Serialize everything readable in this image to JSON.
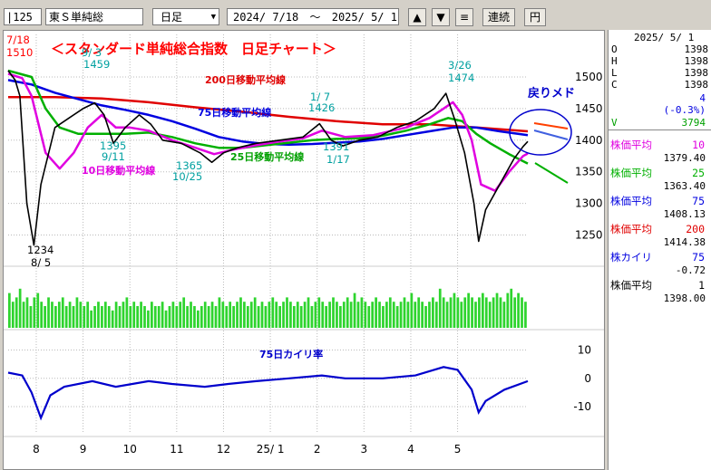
{
  "toolbar": {
    "code": "125",
    "name": "東Ｓ単純総",
    "period": "日足",
    "range_start": "2024/ 7/18",
    "range_sep": "～",
    "range_end": "2025/ 5/ 1",
    "btn_up": "▲",
    "btn_down": "▼",
    "btn_menu": "≡",
    "btn_renzoku": "連続",
    "btn_yen": "円"
  },
  "side": {
    "date": "2025/ 5/ 1",
    "ohlc": [
      {
        "k": "O",
        "v": "1398"
      },
      {
        "k": "H",
        "v": "1398"
      },
      {
        "k": "L",
        "v": "1398"
      },
      {
        "k": "C",
        "v": "1398"
      }
    ],
    "change": "4",
    "change_pct": "(-0.3%)",
    "volume_label": "V",
    "volume": "3794",
    "indicators": [
      {
        "label": "株価平均",
        "period": "10",
        "value": "1379.40",
        "color": "#e000e0"
      },
      {
        "label": "株価平均",
        "period": "25",
        "value": "1363.40",
        "color": "#00b000"
      },
      {
        "label": "株価平均",
        "period": "75",
        "value": "1408.13",
        "color": "#0000e0"
      },
      {
        "label": "株価平均",
        "period": "200",
        "value": "1414.38",
        "color": "#e00000"
      },
      {
        "label": "株カイリ",
        "period": "75",
        "value": "-0.72",
        "color": "#0000e0"
      },
      {
        "label": "株価平均",
        "period": "1",
        "value": "1398.00",
        "color": "#000000"
      }
    ]
  },
  "chart": {
    "title": "＜スタンダード単純総合指数　日足チャート＞",
    "ma_labels": {
      "ma200": "200日移動平均線",
      "ma75": "75日移動平均線",
      "ma25": "25日移動平均線",
      "ma10": "10日移動平均線"
    },
    "modori": "戻りメド",
    "kairi_label": "75日カイリ率",
    "annotations": [
      {
        "text": "7/18",
        "color": "#ff0000"
      },
      {
        "text": "1510",
        "color": "#ff0000"
      },
      {
        "text": "9/ 3",
        "color": "#00a0a0"
      },
      {
        "text": "1459",
        "color": "#00a0a0"
      },
      {
        "text": "1395",
        "color": "#00a0a0"
      },
      {
        "text": "9/11",
        "color": "#00a0a0"
      },
      {
        "text": "1365",
        "color": "#00a0a0"
      },
      {
        "text": "10/25",
        "color": "#00a0a0"
      },
      {
        "text": "1/ 7",
        "color": "#00a0a0"
      },
      {
        "text": "1426",
        "color": "#00a0a0"
      },
      {
        "text": "1391",
        "color": "#00a0a0"
      },
      {
        "text": "1/17",
        "color": "#00a0a0"
      },
      {
        "text": "3/26",
        "color": "#00a0a0"
      },
      {
        "text": "1474",
        "color": "#00a0a0"
      },
      {
        "text": "1234",
        "color": "#000000"
      },
      {
        "text": "8/ 5",
        "color": "#000000"
      }
    ]
  },
  "chart_data": {
    "type": "line",
    "x_ticks": [
      "8",
      "9",
      "10",
      "11",
      "12",
      "25/ 1",
      "2",
      "3",
      "4",
      "5"
    ],
    "y_ticks": [
      1500,
      1450,
      1400,
      1350,
      1300,
      1250
    ],
    "ylim": [
      1215,
      1530
    ],
    "kairi_ticks": [
      10,
      0,
      -10
    ],
    "kairi_ylim": [
      -18,
      14
    ],
    "colors": {
      "price": "#000000",
      "ma10": "#e000e0",
      "ma25": "#00b000",
      "ma75": "#0000e0",
      "ma200": "#e00000",
      "volume": "#2ed42e",
      "kairi": "#0000cc"
    },
    "series": [
      {
        "name": "price",
        "points": [
          [
            0,
            1510
          ],
          [
            0.15,
            1495
          ],
          [
            0.25,
            1470
          ],
          [
            0.4,
            1300
          ],
          [
            0.55,
            1234
          ],
          [
            0.7,
            1330
          ],
          [
            1.0,
            1420
          ],
          [
            1.3,
            1435
          ],
          [
            1.6,
            1450
          ],
          [
            1.85,
            1459
          ],
          [
            2.05,
            1440
          ],
          [
            2.25,
            1395
          ],
          [
            2.5,
            1420
          ],
          [
            2.8,
            1440
          ],
          [
            3.05,
            1425
          ],
          [
            3.3,
            1400
          ],
          [
            3.7,
            1395
          ],
          [
            4.1,
            1380
          ],
          [
            4.35,
            1365
          ],
          [
            4.6,
            1380
          ],
          [
            4.9,
            1388
          ],
          [
            5.3,
            1395
          ],
          [
            5.8,
            1400
          ],
          [
            6.3,
            1405
          ],
          [
            6.65,
            1426
          ],
          [
            6.9,
            1400
          ],
          [
            7.15,
            1391
          ],
          [
            7.5,
            1400
          ],
          [
            7.9,
            1405
          ],
          [
            8.3,
            1420
          ],
          [
            8.7,
            1430
          ],
          [
            9.1,
            1450
          ],
          [
            9.35,
            1474
          ],
          [
            9.55,
            1430
          ],
          [
            9.75,
            1380
          ],
          [
            9.95,
            1300
          ],
          [
            10.05,
            1240
          ],
          [
            10.2,
            1290
          ],
          [
            10.5,
            1330
          ],
          [
            10.8,
            1370
          ],
          [
            11.0,
            1390
          ],
          [
            11.1,
            1398
          ]
        ]
      },
      {
        "name": "ma10",
        "points": [
          [
            0,
            1505
          ],
          [
            0.3,
            1498
          ],
          [
            0.5,
            1470
          ],
          [
            0.8,
            1380
          ],
          [
            1.1,
            1355
          ],
          [
            1.4,
            1380
          ],
          [
            1.7,
            1420
          ],
          [
            2.0,
            1440
          ],
          [
            2.3,
            1420
          ],
          [
            2.6,
            1420
          ],
          [
            3.0,
            1415
          ],
          [
            3.5,
            1400
          ],
          [
            4.0,
            1388
          ],
          [
            4.4,
            1378
          ],
          [
            4.8,
            1385
          ],
          [
            5.3,
            1392
          ],
          [
            5.8,
            1398
          ],
          [
            6.3,
            1403
          ],
          [
            6.7,
            1415
          ],
          [
            7.2,
            1405
          ],
          [
            7.8,
            1408
          ],
          [
            8.5,
            1420
          ],
          [
            9.0,
            1435
          ],
          [
            9.3,
            1450
          ],
          [
            9.5,
            1460
          ],
          [
            9.7,
            1440
          ],
          [
            9.9,
            1400
          ],
          [
            10.1,
            1330
          ],
          [
            10.4,
            1320
          ],
          [
            10.7,
            1350
          ],
          [
            11.0,
            1375
          ],
          [
            11.1,
            1379
          ]
        ]
      },
      {
        "name": "ma25",
        "points": [
          [
            0,
            1510
          ],
          [
            0.5,
            1500
          ],
          [
            0.8,
            1450
          ],
          [
            1.1,
            1420
          ],
          [
            1.5,
            1410
          ],
          [
            2.0,
            1410
          ],
          [
            2.5,
            1410
          ],
          [
            3.0,
            1412
          ],
          [
            3.5,
            1405
          ],
          [
            4.0,
            1395
          ],
          [
            4.5,
            1388
          ],
          [
            5.0,
            1388
          ],
          [
            5.5,
            1392
          ],
          [
            6.0,
            1396
          ],
          [
            6.5,
            1400
          ],
          [
            7.0,
            1402
          ],
          [
            7.5,
            1403
          ],
          [
            8.0,
            1407
          ],
          [
            8.5,
            1415
          ],
          [
            9.0,
            1425
          ],
          [
            9.4,
            1435
          ],
          [
            9.7,
            1430
          ],
          [
            10.0,
            1410
          ],
          [
            10.3,
            1395
          ],
          [
            10.7,
            1378
          ],
          [
            11.1,
            1363
          ]
        ]
      },
      {
        "name": "ma75",
        "points": [
          [
            0,
            1495
          ],
          [
            0.5,
            1488
          ],
          [
            1.0,
            1475
          ],
          [
            1.5,
            1465
          ],
          [
            2.0,
            1455
          ],
          [
            2.5,
            1448
          ],
          [
            3.0,
            1440
          ],
          [
            3.5,
            1430
          ],
          [
            4.0,
            1418
          ],
          [
            4.5,
            1405
          ],
          [
            5.0,
            1398
          ],
          [
            5.5,
            1394
          ],
          [
            6.0,
            1393
          ],
          [
            6.5,
            1394
          ],
          [
            7.0,
            1396
          ],
          [
            7.5,
            1398
          ],
          [
            8.0,
            1402
          ],
          [
            8.5,
            1408
          ],
          [
            9.0,
            1414
          ],
          [
            9.5,
            1420
          ],
          [
            10.0,
            1420
          ],
          [
            10.5,
            1414
          ],
          [
            11.1,
            1408
          ]
        ]
      },
      {
        "name": "ma200",
        "points": [
          [
            0,
            1468
          ],
          [
            1.0,
            1468
          ],
          [
            2.0,
            1466
          ],
          [
            3.0,
            1460
          ],
          [
            4.0,
            1452
          ],
          [
            5.0,
            1445
          ],
          [
            6.0,
            1437
          ],
          [
            7.0,
            1430
          ],
          [
            8.0,
            1425
          ],
          [
            9.0,
            1425
          ],
          [
            10.0,
            1420
          ],
          [
            11.1,
            1414
          ]
        ]
      },
      {
        "name": "kairi75",
        "points": [
          [
            0,
            2
          ],
          [
            0.3,
            1
          ],
          [
            0.5,
            -5
          ],
          [
            0.7,
            -14
          ],
          [
            0.9,
            -6
          ],
          [
            1.2,
            -3
          ],
          [
            1.8,
            -1
          ],
          [
            2.3,
            -3
          ],
          [
            3.0,
            -1
          ],
          [
            3.5,
            -2
          ],
          [
            4.2,
            -3
          ],
          [
            4.7,
            -2
          ],
          [
            5.3,
            -1
          ],
          [
            6.0,
            0
          ],
          [
            6.7,
            1
          ],
          [
            7.2,
            0
          ],
          [
            8.0,
            0
          ],
          [
            8.7,
            1
          ],
          [
            9.3,
            4
          ],
          [
            9.6,
            3
          ],
          [
            9.9,
            -4
          ],
          [
            10.05,
            -12
          ],
          [
            10.2,
            -8
          ],
          [
            10.6,
            -4
          ],
          [
            11.1,
            -1
          ]
        ]
      }
    ],
    "volume_levels": [
      0.8,
      0.6,
      0.7,
      0.9,
      0.6,
      0.7,
      0.5,
      0.7,
      0.8,
      0.6,
      0.5,
      0.7,
      0.6,
      0.5,
      0.6,
      0.7,
      0.5,
      0.6,
      0.5,
      0.7,
      0.6,
      0.5,
      0.6,
      0.4,
      0.5,
      0.6,
      0.5,
      0.6,
      0.5,
      0.4,
      0.6,
      0.5,
      0.6,
      0.7,
      0.5,
      0.6,
      0.5,
      0.6,
      0.5,
      0.4,
      0.6,
      0.5,
      0.5,
      0.6,
      0.4,
      0.5,
      0.6,
      0.5,
      0.6,
      0.7,
      0.5,
      0.6,
      0.5,
      0.4,
      0.5,
      0.6,
      0.5,
      0.6,
      0.5,
      0.7,
      0.6,
      0.5,
      0.6,
      0.5,
      0.6,
      0.7,
      0.6,
      0.5,
      0.6,
      0.7,
      0.5,
      0.6,
      0.5,
      0.6,
      0.7,
      0.6,
      0.5,
      0.6,
      0.7,
      0.6,
      0.5,
      0.6,
      0.5,
      0.6,
      0.7,
      0.5,
      0.6,
      0.7,
      0.6,
      0.5,
      0.6,
      0.7,
      0.6,
      0.5,
      0.6,
      0.7,
      0.6,
      0.8,
      0.6,
      0.7,
      0.6,
      0.5,
      0.6,
      0.7,
      0.6,
      0.5,
      0.6,
      0.7,
      0.6,
      0.5,
      0.6,
      0.7,
      0.6,
      0.8,
      0.6,
      0.7,
      0.6,
      0.5,
      0.6,
      0.7,
      0.6,
      0.9,
      0.7,
      0.6,
      0.7,
      0.8,
      0.7,
      0.6,
      0.7,
      0.8,
      0.7,
      0.6,
      0.7,
      0.8,
      0.7,
      0.6,
      0.7,
      0.8,
      0.7,
      0.6,
      0.8,
      0.9,
      0.7,
      0.8,
      0.7,
      0.6
    ]
  }
}
